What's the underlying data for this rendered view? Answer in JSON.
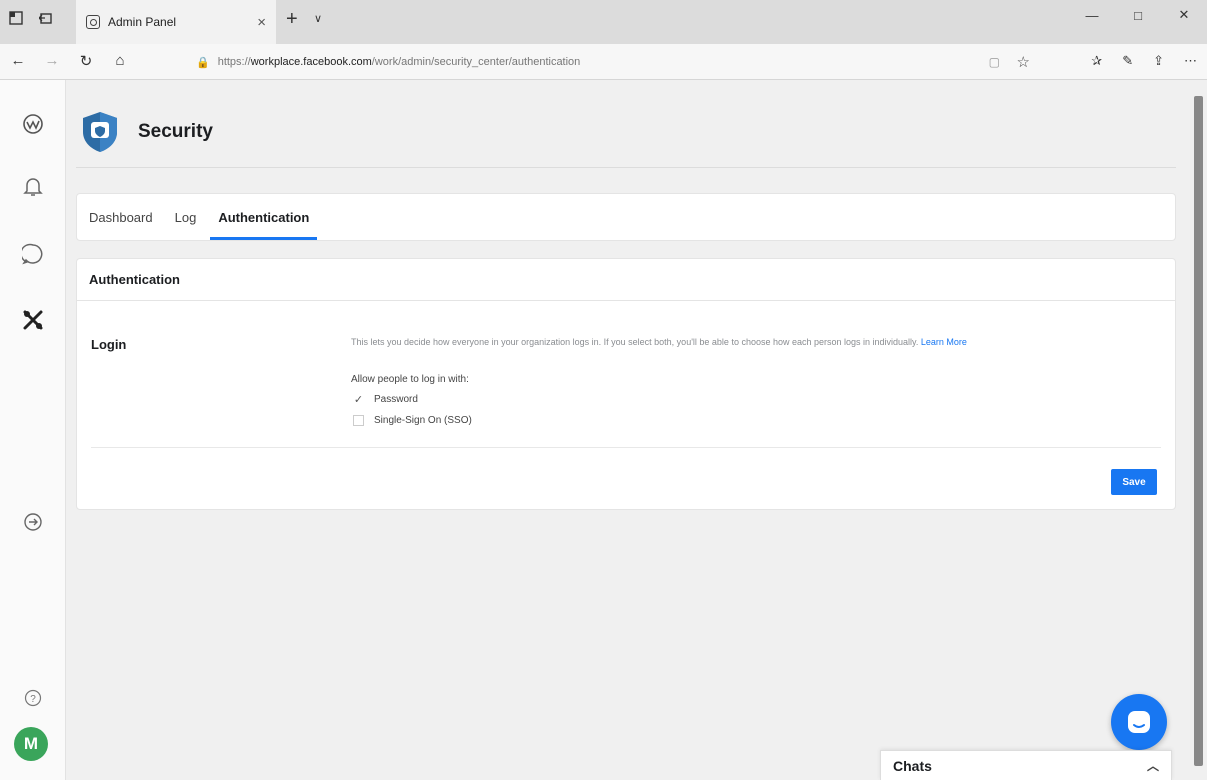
{
  "browser": {
    "tab_title": "Admin Panel",
    "tab_close": "×",
    "new_tab": "+",
    "tab_dropdown": "∨",
    "url_prefix": "https://",
    "url_domain": "workplace.facebook.com",
    "url_path": "/work/admin/security_center/authentication",
    "window_minimize": "—",
    "window_maximize": "□",
    "window_close": "✕"
  },
  "page": {
    "title": "Security",
    "tabs": [
      {
        "label": "Dashboard"
      },
      {
        "label": "Log"
      },
      {
        "label": "Authentication"
      }
    ]
  },
  "card": {
    "heading": "Authentication",
    "login_label": "Login",
    "description": "This lets you decide how everyone in your organization logs in. If you select both, you'll be able to choose how each person logs in individually.",
    "learn_more": "Learn More",
    "allow_label": "Allow people to log in with:",
    "options": [
      {
        "label": "Password",
        "checked": true
      },
      {
        "label": "Single-Sign On (SSO)",
        "checked": false
      }
    ],
    "save_label": "Save"
  },
  "chat": {
    "label": "Chats"
  },
  "avatar": {
    "initial": "M"
  },
  "colors": {
    "accent": "#1877f2",
    "avatar": "#3aa55b"
  }
}
